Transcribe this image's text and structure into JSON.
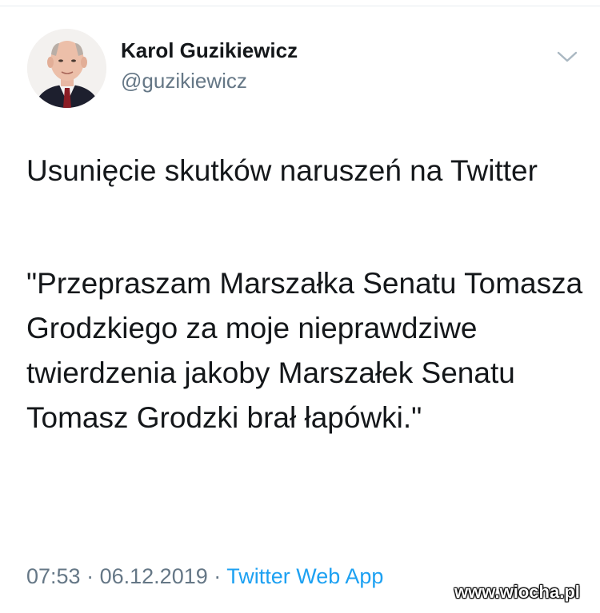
{
  "tweet": {
    "author": {
      "name": "Karol Guzikiewicz",
      "handle": "@guzikiewicz"
    },
    "paragraphs": [
      "Usunięcie skutków naruszeń na Twitter",
      "\"Przepraszam Marszałka Senatu Tomasza Grodzkiego za moje nieprawdziwe twierdzenia jakoby Marszałek Senatu Tomasz Grodzki brał łapówki.\""
    ],
    "time": "07:53",
    "separator": "·",
    "date": "06.12.2019",
    "source": "Twitter Web App"
  },
  "watermark": "www.wiocha.pl",
  "colors": {
    "text": "#14171a",
    "secondary": "#657786",
    "link": "#1da1f2",
    "divider": "#e6ecf0"
  },
  "icons": {
    "menu": "chevron-down-icon"
  }
}
